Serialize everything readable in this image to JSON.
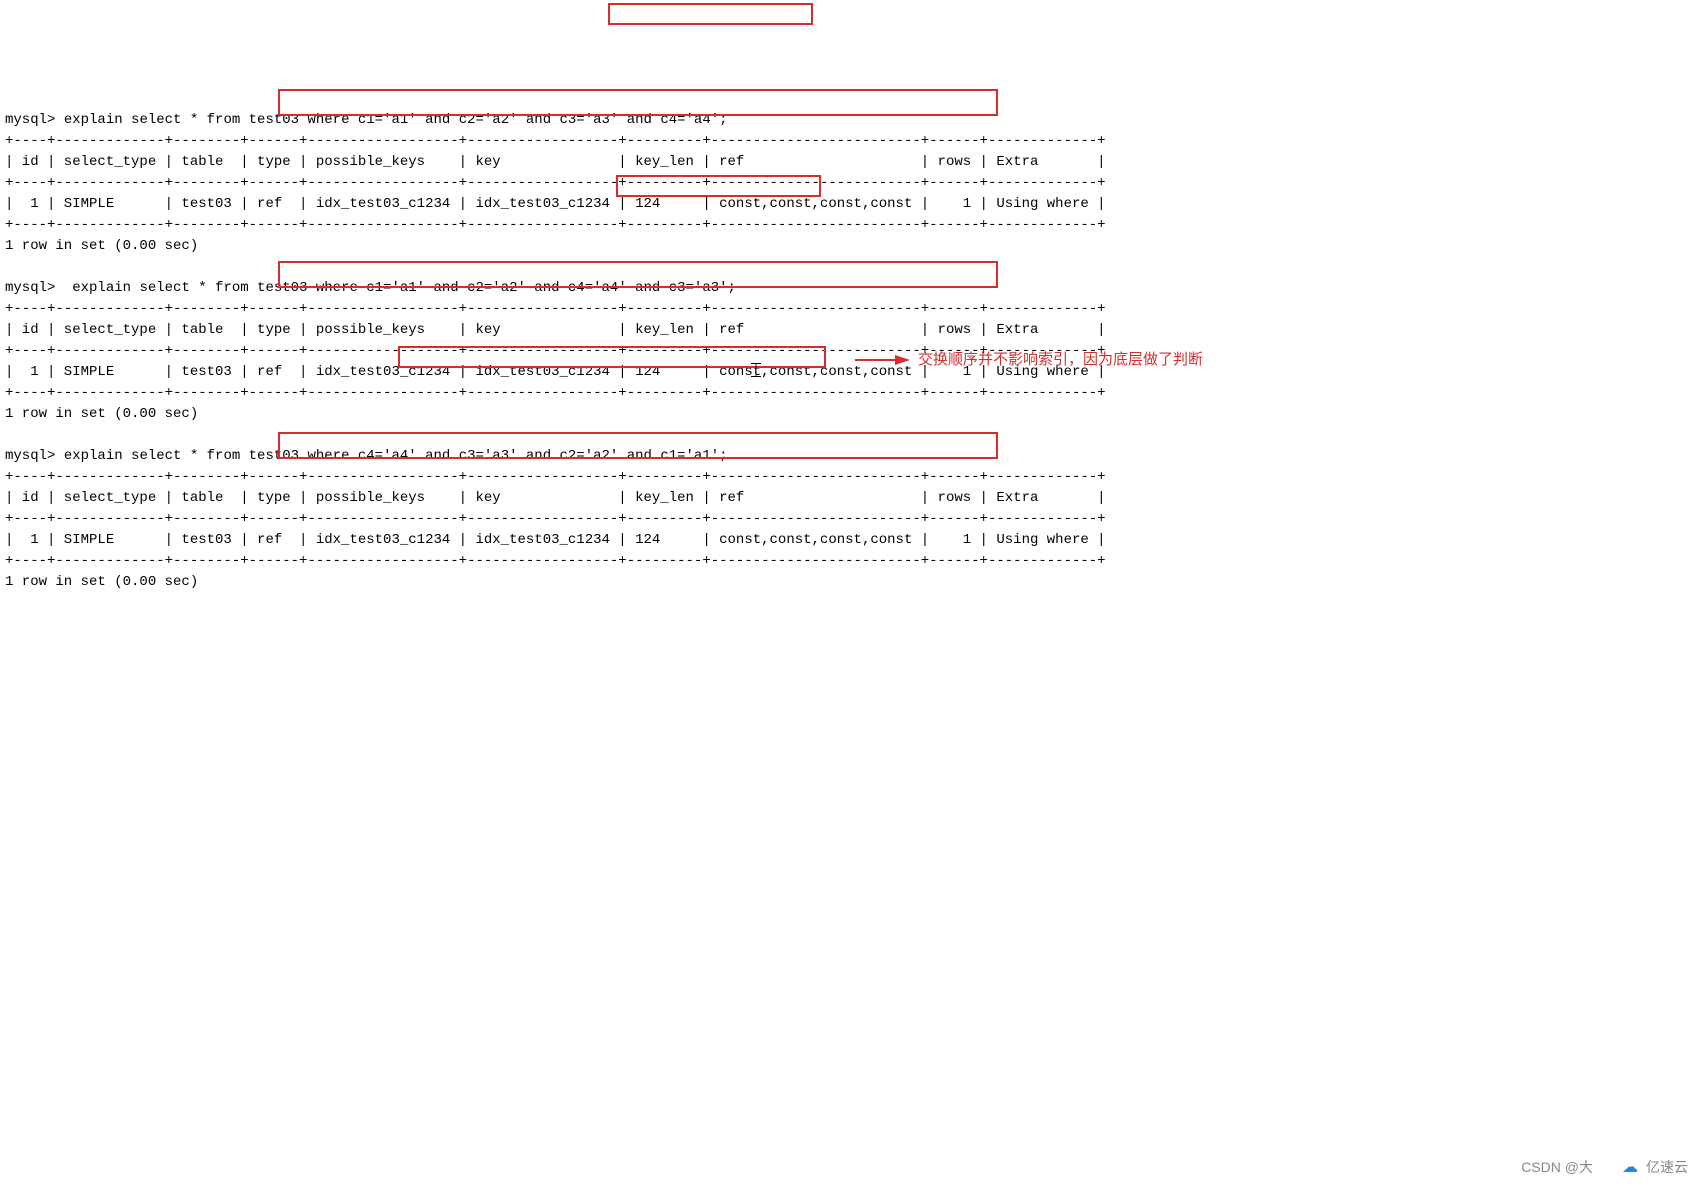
{
  "prompt": "mysql>",
  "queries": [
    "explain select * from test03 where c1='a1' and c2='a2' and c3='a3' and c4='a4';",
    " explain select * from test03 where c1='a1' and c2='a2' and c4='a4' and c3='a3';",
    "explain select * from test03 where c4='a4' and c3='a3' and c2='a2' and c1='a1';"
  ],
  "table_border": "+----+-------------+--------+------+------------------+------------------+---------+-------------------------+------+-------------+",
  "table_header": "| id | select_type | table  | type | possible_keys    | key              | key_len | ref                     | rows | Extra       |",
  "table_row": "|  1 | SIMPLE      | test03 | ref  | idx_test03_c1234 | idx_test03_c1234 | 124     | const,const,const,const |    1 | Using where |",
  "result_msg": "1 row in set (0.00 sec)",
  "annotation_text": "交换顺序并不影响索引，因为底层做了判断",
  "watermark_csdn": "CSDN @大",
  "watermark_yisu": "亿速云"
}
